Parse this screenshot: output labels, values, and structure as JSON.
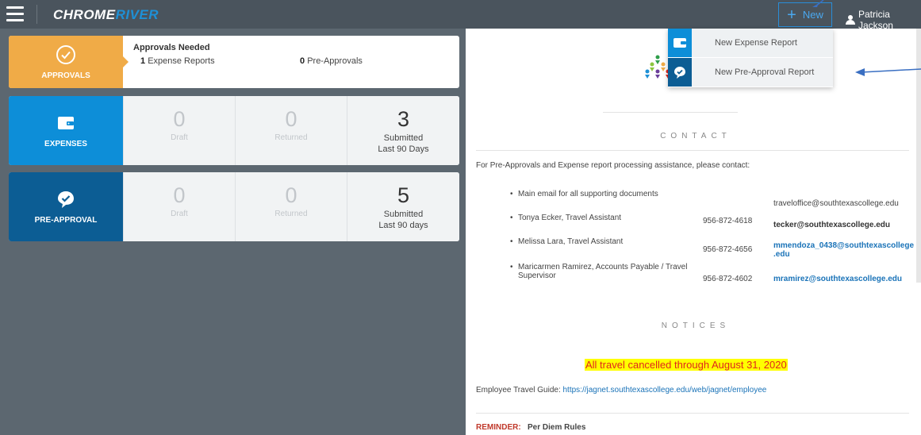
{
  "header": {
    "logo_part1": "CHROME",
    "logo_part2": "RIVER",
    "new_label": "New",
    "user_name": "Patricia Jackson"
  },
  "new_menu": {
    "items": [
      {
        "label": "New Expense Report",
        "icon": "wallet-icon"
      },
      {
        "label": "New Pre-Approval Report",
        "icon": "check-badge-icon"
      }
    ]
  },
  "approvals": {
    "tile_label": "APPROVALS",
    "title": "Approvals Needed",
    "expense_count": "1",
    "expense_label": "Expense Reports",
    "pre_count": "0",
    "pre_label": "Pre-Approvals"
  },
  "expenses": {
    "tile_label": "EXPENSES",
    "draft_num": "0",
    "draft_label": "Draft",
    "returned_num": "0",
    "returned_label": "Returned",
    "submitted_num": "3",
    "submitted_label": "Submitted",
    "submitted_sub": "Last 90 Days"
  },
  "preapproval": {
    "tile_label": "PRE-APPROVAL",
    "draft_num": "0",
    "draft_label": "Draft",
    "returned_num": "0",
    "returned_label": "Returned",
    "submitted_num": "5",
    "submitted_label": "Submitted",
    "submitted_sub": "Last 90 days"
  },
  "contact": {
    "heading": "CONTACT",
    "intro": "For Pre-Approvals and Expense report processing assistance, please contact:",
    "rows": [
      {
        "name": "Main email for all supporting documents",
        "phone": "",
        "email": "traveloffice@southtexascollege.edu"
      },
      {
        "name": "Tonya Ecker, Travel Assistant",
        "phone": "956-872-4618",
        "email": "tecker@southtexascollege.edu"
      },
      {
        "name": "Melissa Lara, Travel Assistant",
        "phone": "956-872-4656",
        "email_line1": "mmendoza_0438@southtexascollege",
        "email_line2": ".edu"
      },
      {
        "name_line1": "Maricarmen Ramirez, Accounts Payable / Travel",
        "name_line2": "Supervisor",
        "phone": "956-872-4602",
        "email": "mramirez@southtexascollege.edu"
      }
    ]
  },
  "notices": {
    "heading": "NOTICES",
    "alert": "All travel cancelled through August 31, 2020",
    "guide_label": "Employee Travel Guide: ",
    "guide_link": "https://jagnet.southtexascollege.edu/web/jagnet/employee",
    "reminder_label": "REMINDER:",
    "reminder_text": "Per Diem Rules"
  },
  "colors": {
    "approvals": "#f0ab47",
    "expenses": "#0d8ed8",
    "preapproval": "#0c5d94",
    "topbar": "#4a545d",
    "alert_bg": "#ffff00",
    "alert_text": "#e0261c"
  }
}
